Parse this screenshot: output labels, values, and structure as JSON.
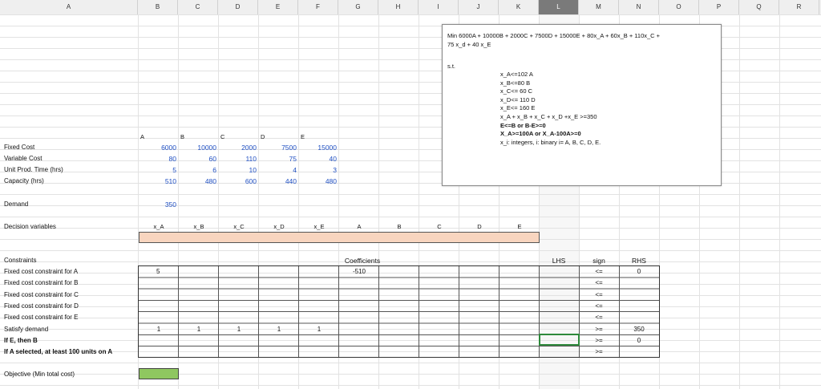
{
  "columns": [
    "A",
    "B",
    "C",
    "D",
    "E",
    "F",
    "G",
    "H",
    "I",
    "J",
    "K",
    "L",
    "M",
    "N",
    "O",
    "P",
    "Q",
    "R"
  ],
  "selected_column": "L",
  "colors": {
    "decision_fill": "#f8d5bf",
    "objective_fill": "#8fc760",
    "input_blue": "#1f4fc2",
    "selected_border": "#2f8a3c"
  },
  "params": {
    "letters": [
      "A",
      "B",
      "C",
      "D",
      "E"
    ],
    "rows": [
      {
        "label": "Fixed Cost",
        "values": [
          "6000",
          "10000",
          "2000",
          "7500",
          "15000"
        ]
      },
      {
        "label": "Variable Cost",
        "values": [
          "80",
          "60",
          "110",
          "75",
          "40"
        ]
      },
      {
        "label": "Unit Prod. Time (hrs)",
        "values": [
          "5",
          "6",
          "10",
          "4",
          "3"
        ]
      },
      {
        "label": "Capacity (hrs)",
        "values": [
          "510",
          "480",
          "600",
          "440",
          "480"
        ]
      }
    ]
  },
  "demand": {
    "label": "Demand",
    "value": "350"
  },
  "decision": {
    "label": "Decision variables",
    "headers": [
      "x_A",
      "x_B",
      "x_C",
      "x_D",
      "x_E",
      "A",
      "B",
      "C",
      "D",
      "E"
    ]
  },
  "constraints": {
    "title": "Constraints",
    "coefficients_label": "Coefficients",
    "lhs_label": "LHS",
    "sign_label": "sign",
    "rhs_label": "RHS",
    "rows": [
      {
        "label": "Fixed cost constraint for A",
        "bold": false,
        "values": [
          "5",
          "",
          "",
          "",
          "",
          "-510",
          "",
          "",
          "",
          "",
          "",
          "",
          ""
        ],
        "sign": "<=",
        "rhs": "0"
      },
      {
        "label": "Fixed cost constraint for B",
        "bold": false,
        "values": [
          "",
          "",
          "",
          "",
          "",
          "",
          "",
          "",
          "",
          "",
          "",
          "",
          ""
        ],
        "sign": "<=",
        "rhs": ""
      },
      {
        "label": "Fixed cost constraint for C",
        "bold": false,
        "values": [
          "",
          "",
          "",
          "",
          "",
          "",
          "",
          "",
          "",
          "",
          "",
          "",
          ""
        ],
        "sign": "<=",
        "rhs": ""
      },
      {
        "label": "Fixed cost constraint for D",
        "bold": false,
        "values": [
          "",
          "",
          "",
          "",
          "",
          "",
          "",
          "",
          "",
          "",
          "",
          "",
          ""
        ],
        "sign": "<=",
        "rhs": ""
      },
      {
        "label": "Fixed cost constraint for E",
        "bold": false,
        "values": [
          "",
          "",
          "",
          "",
          "",
          "",
          "",
          "",
          "",
          "",
          "",
          "",
          ""
        ],
        "sign": "<=",
        "rhs": ""
      },
      {
        "label": "Satisfy demand",
        "bold": false,
        "values": [
          "1",
          "1",
          "1",
          "1",
          "1",
          "",
          "",
          "",
          "",
          "",
          "",
          "",
          ""
        ],
        "sign": ">=",
        "rhs": "350"
      },
      {
        "label": "If E, then B",
        "bold": true,
        "values": [
          "",
          "",
          "",
          "",
          "",
          "",
          "",
          "",
          "",
          "",
          "",
          "",
          ""
        ],
        "sign": ">=",
        "rhs": "0"
      },
      {
        "label": "If A selected, at least 100 units on A",
        "bold": true,
        "values": [
          "",
          "",
          "",
          "",
          "",
          "",
          "",
          "",
          "",
          "",
          "",
          "",
          ""
        ],
        "sign": ">=",
        "rhs": ""
      }
    ]
  },
  "objective": {
    "label": "Objective (Min total cost)"
  },
  "model": {
    "objective_line1": "Min 6000A + 10000B + 2000C + 7500D + 15000E + 80x_A + 60x_B + 110x_C +",
    "objective_line2": "75 x_d + 40 x_E",
    "st": "s.t.",
    "constraints": [
      {
        "text": "x_A<=102 A",
        "bold": false
      },
      {
        "text": "x_B<=80 B",
        "bold": false
      },
      {
        "text": "x_C<= 60 C",
        "bold": false
      },
      {
        "text": "x_D<= 110 D",
        "bold": false
      },
      {
        "text": "x_E<= 160 E",
        "bold": false
      },
      {
        "text": "x_A + x_B + x_C + x_D +x_E >=350",
        "bold": false
      },
      {
        "text": "E<=B or B-E>=0",
        "bold": true
      },
      {
        "text": "X_A>=100A or X_A-100A>=0",
        "bold": true
      },
      {
        "text": "x_i: integers, i: binary i= A, B, C, D, E.",
        "bold": false
      }
    ]
  }
}
